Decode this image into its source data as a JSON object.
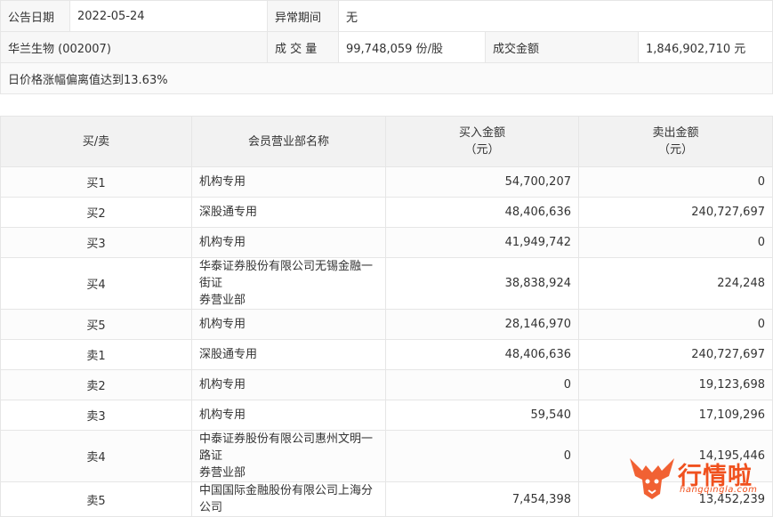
{
  "info": {
    "announce_date_label": "公告日期",
    "announce_date": "2022-05-24",
    "abnormal_period_label": "异常期间",
    "abnormal_period": "无",
    "stock": "华兰生物 (002007)",
    "volume_label": "成 交 量",
    "volume": "99,748,059 份/股",
    "turnover_label": "成交金额",
    "turnover": "1,846,902,710 元",
    "reason": "日价格涨幅偏离值达到13.63%"
  },
  "table": {
    "headers": {
      "side": "买/卖",
      "dept": "会员营业部名称",
      "buy": "买入金额",
      "buy_unit": "（元）",
      "sell": "卖出金额",
      "sell_unit": "（元）"
    },
    "rows": [
      {
        "side": "买1",
        "dept": "机构专用",
        "buy": "54,700,207",
        "sell": "0"
      },
      {
        "side": "买2",
        "dept": "深股通专用",
        "buy": "48,406,636",
        "sell": "240,727,697"
      },
      {
        "side": "买3",
        "dept": "机构专用",
        "buy": "41,949,742",
        "sell": "0"
      },
      {
        "side": "买4",
        "dept_line1": "华泰证券股份有限公司无锡金融一街证",
        "dept_line2": "券营业部",
        "buy": "38,838,924",
        "sell": "224,248"
      },
      {
        "side": "买5",
        "dept": "机构专用",
        "buy": "28,146,970",
        "sell": "0"
      },
      {
        "side": "卖1",
        "dept": "深股通专用",
        "buy": "48,406,636",
        "sell": "240,727,697"
      },
      {
        "side": "卖2",
        "dept": "机构专用",
        "buy": "0",
        "sell": "19,123,698"
      },
      {
        "side": "卖3",
        "dept": "机构专用",
        "buy": "59,540",
        "sell": "17,109,296"
      },
      {
        "side": "卖4",
        "dept_line1": "中泰证券股份有限公司惠州文明一路证",
        "dept_line2": "券营业部",
        "buy": "0",
        "sell": "14,195,446"
      },
      {
        "side": "卖5",
        "dept": "中国国际金融股份有限公司上海分公司",
        "buy": "7,454,398",
        "sell": "13,452,239"
      }
    ]
  },
  "watermark": {
    "brand": "行情啦",
    "url": "hangqingla.com",
    "color": "#f0511e"
  }
}
